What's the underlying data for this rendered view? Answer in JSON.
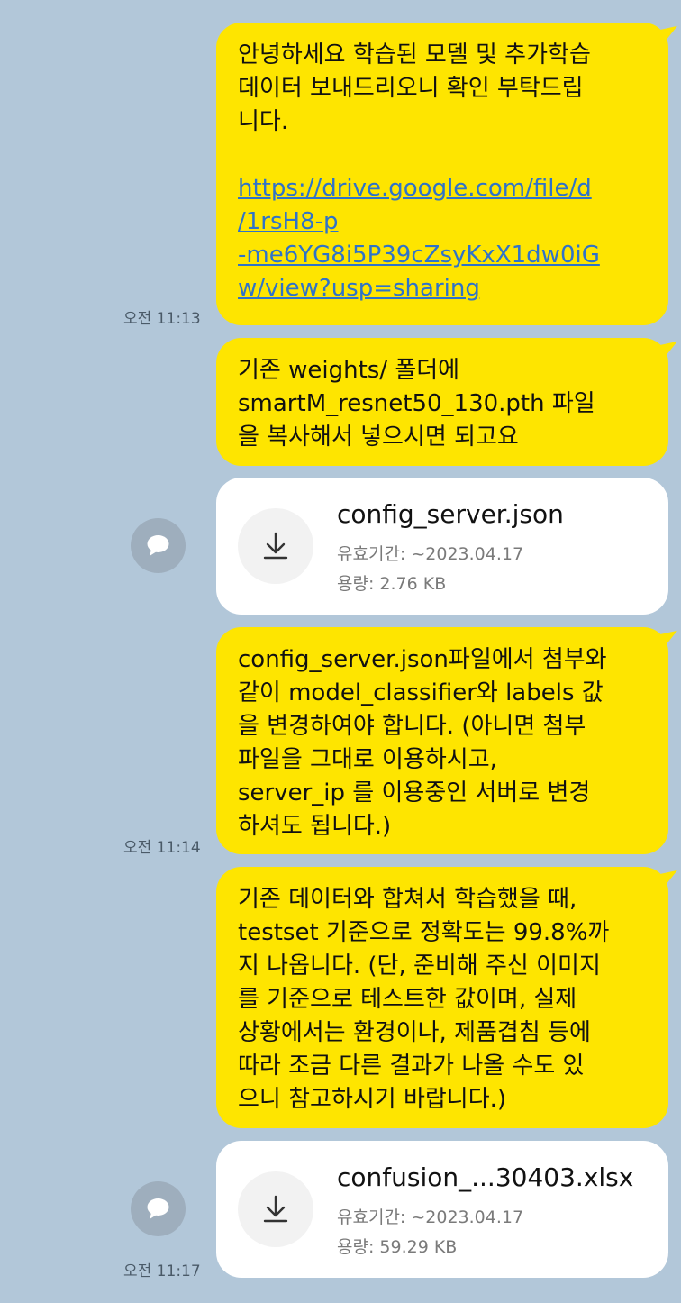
{
  "chat": {
    "messages": [
      {
        "lines": [
          "안녕하세요 학습된 모델 및 추가학습",
          "데이터 보내드리오니 확인 부탁드립",
          "니다."
        ],
        "link_lines": [
          "https://drive.google.com/file/d",
          "/1rsH8-p",
          "-me6YG8i5P39cZsyKxX1dw0iG",
          "w/view?usp=sharing"
        ],
        "time": "오전 11:13"
      },
      {
        "lines": [
          "기존 weights/ 폴더에",
          "smartM_resnet50_130.pth 파일",
          "을 복사해서 넣으시면 되고요"
        ]
      },
      {
        "file_name": "config_server.json",
        "expiry": "유효기간: ~2023.04.17",
        "size": "용량: 2.76 KB"
      },
      {
        "lines": [
          "config_server.json파일에서 첨부와",
          "같이 model_classifier와 labels 값",
          "을 변경하여야 합니다. (아니면 첨부",
          "파일을 그대로 이용하시고,",
          "server_ip 를 이용중인 서버로 변경",
          "하셔도 됩니다.)"
        ],
        "time": "오전 11:14"
      },
      {
        "lines": [
          "기존 데이터와 합쳐서 학습했을 때,",
          "testset 기준으로 정확도는 99.8%까",
          "지 나옵니다. (단, 준비해 주신 이미지",
          "를 기준으로 테스트한 값이며, 실제",
          "상황에서는 환경이나, 제품겹침 등에",
          "따라 조금 다른 결과가 나올 수도 있",
          "으니 참고하시기 바랍니다.)"
        ]
      },
      {
        "file_name": "confusion_...30403.xlsx",
        "expiry": "유효기간: ~2023.04.17",
        "size": "용량: 59.29 KB",
        "time": "오전 11:17"
      }
    ]
  },
  "colors": {
    "background": "#b2c7d9",
    "my_bubble": "#fee500",
    "file_card": "#ffffff",
    "link": "#2f73c9"
  },
  "icons": {
    "download": "download-icon",
    "share": "share-icon"
  }
}
